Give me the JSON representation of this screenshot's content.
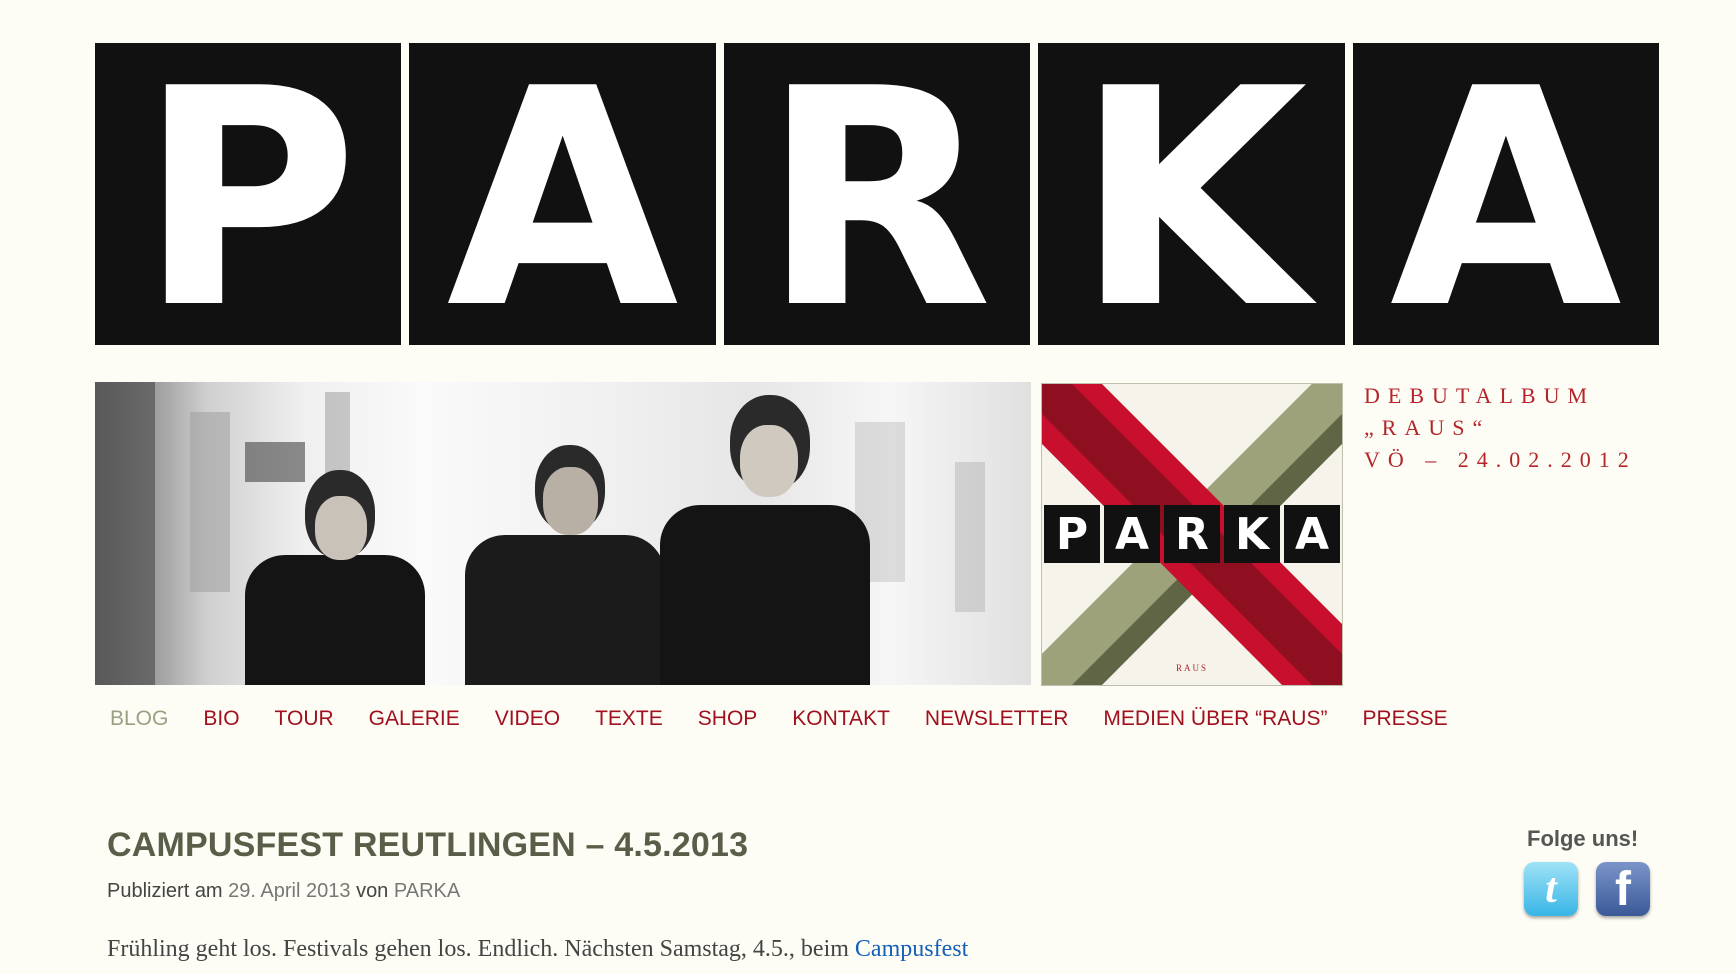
{
  "logo": {
    "letters": [
      "P",
      "A",
      "R",
      "K",
      "A"
    ]
  },
  "album": {
    "band_letters": [
      "P",
      "A",
      "R",
      "K",
      "A"
    ],
    "caption": "RAUS"
  },
  "debut": {
    "line1": "DEBUTALBUM",
    "line2": "„RAUS“",
    "line3": "VÖ – 24.02.2012"
  },
  "nav": {
    "items": [
      {
        "label": "BLOG",
        "active": true
      },
      {
        "label": "BIO"
      },
      {
        "label": "TOUR"
      },
      {
        "label": "GALERIE"
      },
      {
        "label": "VIDEO"
      },
      {
        "label": "TEXTE"
      },
      {
        "label": "SHOP"
      },
      {
        "label": "KONTAKT"
      },
      {
        "label": "NEWSLETTER"
      },
      {
        "label": "MEDIEN ÜBER “RAUS”"
      },
      {
        "label": "PRESSE"
      }
    ]
  },
  "post": {
    "title": "CAMPUSFEST REUTLINGEN – 4.5.2013",
    "meta_prefix": "Publiziert am",
    "date": "29. April 2013",
    "meta_by": "von",
    "author": "PARKA",
    "text": "Frühling geht los. Festivals gehen los. Endlich. Nächsten Samstag, 4.5., beim",
    "link_text": "Campusfest"
  },
  "social": {
    "heading": "Folge uns!",
    "twitter_icon": "twitter-icon",
    "facebook_icon": "facebook-icon",
    "twitter_glyph": "t",
    "facebook_glyph": "f"
  },
  "colors": {
    "background": "#fdfdf5",
    "nav_link": "#a0101e",
    "nav_active": "#9aa080",
    "title": "#5a5e48",
    "link": "#1560b7",
    "accent_red": "#b4252b",
    "album_green": "#8c9468",
    "album_red": "#c8102e"
  }
}
